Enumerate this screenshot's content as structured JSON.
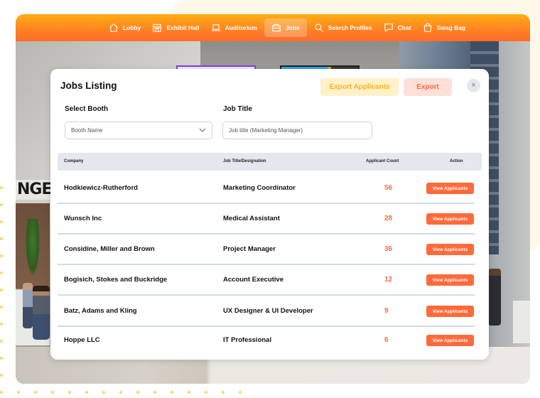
{
  "nav": {
    "items": [
      {
        "label": "Lobby",
        "icon": "home-icon",
        "active": false
      },
      {
        "label": "Exhibit Hall",
        "icon": "storefront-icon",
        "active": false
      },
      {
        "label": "Auditorium",
        "icon": "laptop-icon",
        "active": false
      },
      {
        "label": "Jobs",
        "icon": "briefcase-icon",
        "active": true
      },
      {
        "label": "Search Profiles",
        "icon": "search-icon",
        "active": false
      },
      {
        "label": "Chat",
        "icon": "chat-bubble-icon",
        "active": false
      },
      {
        "label": "Swag Bag",
        "icon": "shopping-bag-icon",
        "active": false
      }
    ]
  },
  "scene": {
    "lounge_sign": "NGE"
  },
  "modal": {
    "title": "Jobs Listing",
    "export_applicants_label": "Export Applicants",
    "export_label": "Export",
    "close_glyph": "×",
    "filters": {
      "booth_label": "Select Booth",
      "booth_value": "Booth Name",
      "job_label": "Job Title",
      "job_placeholder": "Job title (Marketing Manager)"
    },
    "table": {
      "headers": {
        "company": "Company",
        "title": "Job Title/Designation",
        "count": "Applicant Count",
        "action": "Action"
      },
      "rows": [
        {
          "company": "Hodkiewicz-Rutherford",
          "title": "Marketing Coordinator",
          "count": "56",
          "action": "View Applicants"
        },
        {
          "company": "Wunsch Inc",
          "title": "Medical Assistant",
          "count": "28",
          "action": "View Applicants"
        },
        {
          "company": "Considine, Miller and Brown",
          "title": "Project Manager",
          "count": "36",
          "action": "View Applicants"
        },
        {
          "company": "Bogisich, Stokes and Buckridge",
          "title": "Account Executive",
          "count": "12",
          "action": "View Applicants"
        },
        {
          "company": "Batz, Adams and Kling",
          "title": "UX Designer & UI Developer",
          "count": "9",
          "action": "View Applicants"
        },
        {
          "company": "Hoppe LLC",
          "title": "IT Professional",
          "count": "6",
          "action": "View Applicants"
        }
      ]
    }
  },
  "colors": {
    "accent": "#ff6a3a",
    "nav_gradient_top": "#ffad12",
    "nav_gradient_bottom": "#ff6d2a",
    "export_applicants_bg": "#fff1c9",
    "export_applicants_text": "#ffb21a",
    "export_bg": "#ffe0d8",
    "table_header_bg": "#e3e8ee"
  }
}
